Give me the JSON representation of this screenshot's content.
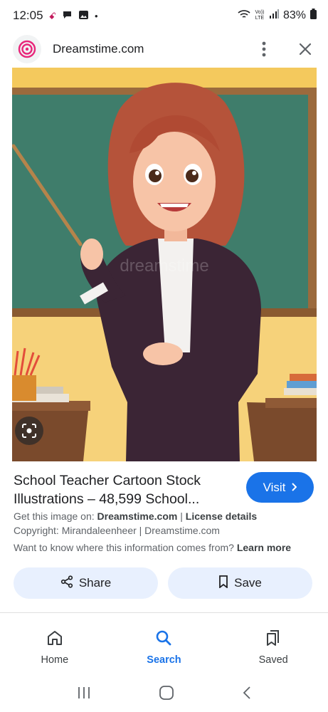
{
  "status_bar": {
    "time": "12:05",
    "signal_text": "Vo)) LTE",
    "battery": "83%"
  },
  "header": {
    "site_name": "Dreamstime.com",
    "favicon_icon": "dreamstime-swirl-icon",
    "menu_icon": "more-vert-icon",
    "close_icon": "close-icon"
  },
  "image": {
    "watermark": "dreamstime",
    "lens_icon": "google-lens-icon"
  },
  "result": {
    "title": "School Teacher Cartoon Stock Illustrations – 48,599 School...",
    "visit_label": "Visit",
    "get_image_prefix": "Get this image on:",
    "get_image_site": "Dreamstime.com",
    "separator": "|",
    "license_label": "License details",
    "copyright": "Copyright: Mirandaleenheer | Dreamstime.com",
    "info_question": "Want to know where this information comes from?",
    "learn_more": "Learn more"
  },
  "actions": {
    "share_label": "Share",
    "save_label": "Save"
  },
  "bottom_nav": {
    "items": [
      {
        "label": "Home",
        "icon": "home-icon"
      },
      {
        "label": "Search",
        "icon": "search-icon"
      },
      {
        "label": "Saved",
        "icon": "bookmarks-icon"
      }
    ],
    "active": "Search"
  },
  "colors": {
    "accent": "#1a73e8",
    "pill_bg": "#e8f0fe",
    "favicon_pink": "#e8267a"
  }
}
